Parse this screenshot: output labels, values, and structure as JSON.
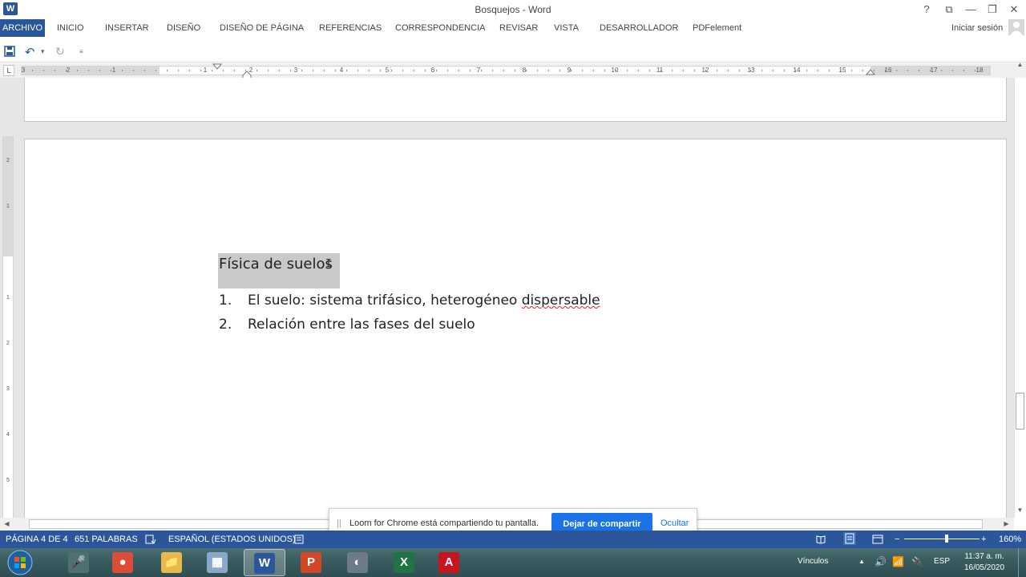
{
  "window": {
    "app_icon": "W",
    "title": "Bosquejos - Word",
    "help": "?",
    "ribbon_display": "⧉",
    "minimize": "—",
    "restore": "❐",
    "close": "✕"
  },
  "ribbon": {
    "tabs": [
      "ARCHIVO",
      "INICIO",
      "INSERTAR",
      "DISEÑO",
      "DISEÑO DE PÁGINA",
      "REFERENCIAS",
      "CORRESPONDENCIA",
      "REVISAR",
      "VISTA",
      "DESARROLLADOR",
      "PDFelement"
    ],
    "signin": "Iniciar sesión"
  },
  "qat": {
    "save": "💾",
    "undo": "↶",
    "undo_drop": "▾",
    "redo": "↻",
    "customize": "≡"
  },
  "ruler": {
    "corner": "L",
    "labels": [
      "3",
      "2",
      "1",
      "1",
      "2",
      "3",
      "4",
      "5",
      "6",
      "7",
      "8",
      "9",
      "10",
      "11",
      "12",
      "13",
      "14",
      "15",
      "16",
      "17",
      "18"
    ],
    "vlabels": [
      "2",
      "1",
      "1",
      "2",
      "3",
      "4",
      "5"
    ]
  },
  "document": {
    "heading": "Física de suelos",
    "list": [
      {
        "num": "1.",
        "text_before": "El suelo: sistema trifásico, heterogéneo ",
        "text_marked": "dispersable"
      },
      {
        "num": "2.",
        "text_before": "Relación entre las fases del suelo",
        "text_marked": ""
      }
    ]
  },
  "loom": {
    "grip": "||",
    "message": "Loom for Chrome está compartiendo tu pantalla.",
    "stop": "Dejar de compartir",
    "hide": "Ocultar"
  },
  "status": {
    "page": "PÁGINA 4 DE 4",
    "words": "651 PALABRAS",
    "language": "ESPAÑOL (ESTADOS UNIDOS)",
    "zoom_minus": "−",
    "zoom_plus": "+",
    "zoom": "160%"
  },
  "taskbar": {
    "apps": [
      {
        "name": "microphone",
        "glyph": "🎤",
        "color": "#4f6f72"
      },
      {
        "name": "chrome",
        "glyph": "●",
        "color": "#dd4b39"
      },
      {
        "name": "explorer",
        "glyph": "📁",
        "color": "#e6b94a"
      },
      {
        "name": "calculator",
        "glyph": "▦",
        "color": "#8aa9c9"
      },
      {
        "name": "word",
        "glyph": "W",
        "color": "#2b579a"
      },
      {
        "name": "powerpoint",
        "glyph": "P",
        "color": "#d24726"
      },
      {
        "name": "earth",
        "glyph": "◐",
        "color": "#6c7b86"
      },
      {
        "name": "excel",
        "glyph": "X",
        "color": "#217346"
      },
      {
        "name": "acrobat",
        "glyph": "A",
        "color": "#c8141e"
      }
    ],
    "links_label": "Vínculos",
    "lang": "ESP",
    "time": "11:37 a. m.",
    "date": "16/05/2020"
  }
}
